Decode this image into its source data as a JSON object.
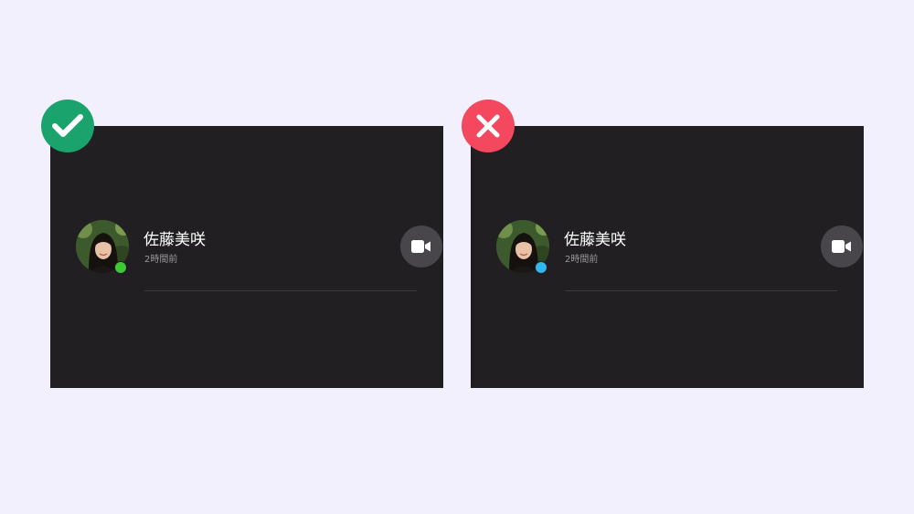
{
  "comparison": {
    "good": {
      "verdict_icon": "checkmark-icon",
      "verdict_color": "#1aa36c",
      "contact": {
        "name": "佐藤美咲",
        "last_seen": "2時間前",
        "status_color": "#3dc935"
      },
      "action_icon": "video-camera-icon"
    },
    "bad": {
      "verdict_icon": "cross-icon",
      "verdict_color": "#f3485e",
      "contact": {
        "name": "佐藤美咲",
        "last_seen": "2時間前",
        "status_color": "#32b7ee"
      },
      "action_icon": "video-camera-icon"
    }
  },
  "colors": {
    "page_background": "#f1f0fc",
    "panel_background": "#211f22",
    "button_background": "#48464b"
  }
}
